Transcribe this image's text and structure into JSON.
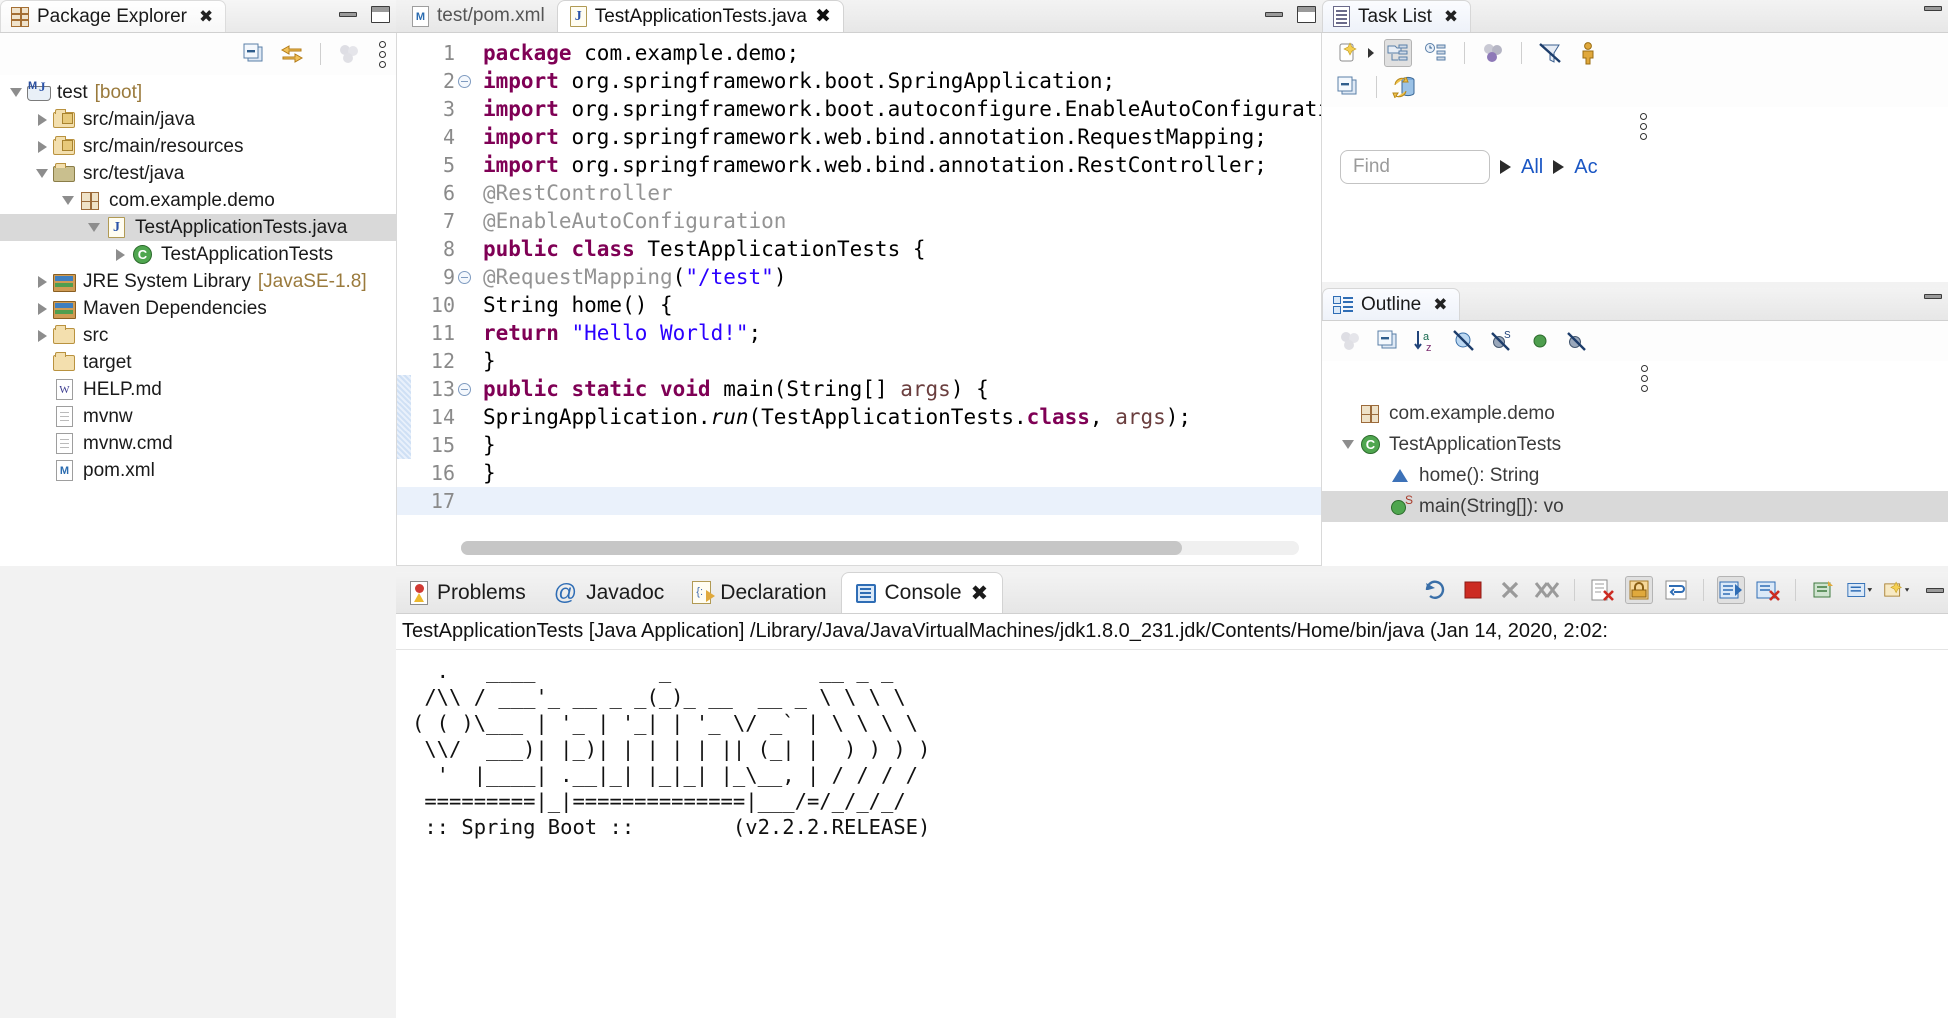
{
  "package_explorer": {
    "tab_label": "Package Explorer",
    "close_icon": "close-icon",
    "toolbar": [
      {
        "name": "collapse-all-icon",
        "label": "Collapse All"
      },
      {
        "name": "link-with-editor-icon",
        "label": "Link with Editor"
      },
      {
        "name": "view-menu-icon",
        "label": "View Menu"
      },
      {
        "name": "view-kebab-icon",
        "label": "View Menu"
      }
    ],
    "tree": [
      {
        "label": "test",
        "suffix": "[boot]",
        "icon": "maven-java-project-icon",
        "twisty": "down",
        "indent": 0,
        "selected": false
      },
      {
        "label": "src/main/java",
        "suffix": "",
        "icon": "source-folder-icon",
        "twisty": "right",
        "indent": 1,
        "selected": false
      },
      {
        "label": "src/main/resources",
        "suffix": "",
        "icon": "source-folder-icon",
        "twisty": "right",
        "indent": 1,
        "selected": false
      },
      {
        "label": "src/test/java",
        "suffix": "",
        "icon": "test-source-folder-icon",
        "twisty": "down",
        "indent": 1,
        "selected": false
      },
      {
        "label": "com.example.demo",
        "suffix": "",
        "icon": "package-icon",
        "twisty": "down",
        "indent": 2,
        "selected": false
      },
      {
        "label": "TestApplicationTests.java",
        "suffix": "",
        "icon": "java-file-icon",
        "twisty": "down",
        "indent": 3,
        "selected": true
      },
      {
        "label": "TestApplicationTests",
        "suffix": "",
        "icon": "java-class-icon",
        "twisty": "right",
        "indent": 4,
        "selected": false
      },
      {
        "label": "JRE System Library",
        "suffix": "[JavaSE-1.8]",
        "icon": "library-icon",
        "twisty": "right",
        "indent": 1,
        "selected": false
      },
      {
        "label": "Maven Dependencies",
        "suffix": "",
        "icon": "library-icon",
        "twisty": "right",
        "indent": 1,
        "selected": false
      },
      {
        "label": "src",
        "suffix": "",
        "icon": "folder-icon",
        "twisty": "right",
        "indent": 1,
        "selected": false
      },
      {
        "label": "target",
        "suffix": "",
        "icon": "folder-icon",
        "twisty": "none",
        "indent": 1,
        "selected": false
      },
      {
        "label": "HELP.md",
        "suffix": "",
        "icon": "markdown-file-icon",
        "twisty": "none",
        "indent": 1,
        "selected": false
      },
      {
        "label": "mvnw",
        "suffix": "",
        "icon": "file-icon",
        "twisty": "none",
        "indent": 1,
        "selected": false
      },
      {
        "label": "mvnw.cmd",
        "suffix": "",
        "icon": "file-icon",
        "twisty": "none",
        "indent": 1,
        "selected": false
      },
      {
        "label": "pom.xml",
        "suffix": "",
        "icon": "xml-file-icon",
        "twisty": "none",
        "indent": 1,
        "selected": false
      }
    ]
  },
  "editor": {
    "tabs": [
      {
        "label": "test/pom.xml",
        "icon": "maven-file-icon",
        "active": false,
        "closable": false
      },
      {
        "label": "TestApplicationTests.java",
        "icon": "java-file-icon",
        "active": true,
        "closable": true
      }
    ],
    "lines": [
      {
        "n": "1",
        "fold": false,
        "marker": false,
        "cursor": false,
        "html": "<span class='kw'>package</span> com.example.demo;"
      },
      {
        "n": "2",
        "fold": true,
        "marker": false,
        "cursor": false,
        "html": "<span class='kw'>import</span> org.springframework.boot.SpringApplication;"
      },
      {
        "n": "3",
        "fold": false,
        "marker": false,
        "cursor": false,
        "html": "<span class='kw'>import</span> org.springframework.boot.autoconfigure.EnableAutoConfiguration;"
      },
      {
        "n": "4",
        "fold": false,
        "marker": false,
        "cursor": false,
        "html": "<span class='kw'>import</span> org.springframework.web.bind.annotation.RequestMapping;"
      },
      {
        "n": "5",
        "fold": false,
        "marker": false,
        "cursor": false,
        "html": "<span class='kw'>import</span> org.springframework.web.bind.annotation.RestController;"
      },
      {
        "n": "6",
        "fold": false,
        "marker": false,
        "cursor": false,
        "html": "<span class='ann'>@RestController</span>"
      },
      {
        "n": "7",
        "fold": false,
        "marker": false,
        "cursor": false,
        "html": "<span class='ann'>@EnableAutoConfiguration</span>"
      },
      {
        "n": "8",
        "fold": false,
        "marker": false,
        "cursor": false,
        "html": "<span class='kw'>public class</span> TestApplicationTests {"
      },
      {
        "n": "9",
        "fold": true,
        "marker": false,
        "cursor": false,
        "html": "<span class='ann'>@RequestMapping</span>(<span class='str'>\"/test\"</span>)"
      },
      {
        "n": "10",
        "fold": false,
        "marker": false,
        "cursor": false,
        "html": "String home() {"
      },
      {
        "n": "11",
        "fold": false,
        "marker": false,
        "cursor": false,
        "html": "<span class='kw'>return</span> <span class='str'>\"Hello World!\"</span>;"
      },
      {
        "n": "12",
        "fold": false,
        "marker": false,
        "cursor": false,
        "html": "}"
      },
      {
        "n": "13",
        "fold": true,
        "marker": true,
        "cursor": false,
        "html": "<span class='kw'>public static void</span> main(String[] <span class='param'>args</span>) {"
      },
      {
        "n": "14",
        "fold": false,
        "marker": true,
        "cursor": false,
        "html": "SpringApplication.<span class='ital'>run</span>(TestApplicationTests.<span class='kw'>class</span>, <span class='param'>args</span>);"
      },
      {
        "n": "15",
        "fold": false,
        "marker": true,
        "cursor": false,
        "html": "}"
      },
      {
        "n": "16",
        "fold": false,
        "marker": false,
        "cursor": false,
        "html": "}"
      },
      {
        "n": "17",
        "fold": false,
        "marker": false,
        "cursor": true,
        "html": ""
      }
    ]
  },
  "task_list": {
    "tab_label": "Task List",
    "toolbar": [
      {
        "name": "new-task-icon"
      },
      {
        "name": "categorized-presentation-icon"
      },
      {
        "name": "scheduled-presentation-icon"
      },
      {
        "name": "focus-on-workweek-icon"
      },
      {
        "name": "filter-completed-icon"
      },
      {
        "name": "show-all-tasks-icon"
      },
      {
        "name": "collapse-all-icon"
      },
      {
        "name": "synchronize-changed-icon"
      }
    ],
    "find_placeholder": "Find",
    "scope_all": "All",
    "scope_activate": "Ac"
  },
  "outline": {
    "tab_label": "Outline",
    "toolbar": [
      {
        "name": "focus-on-active-task-icon"
      },
      {
        "name": "collapse-all-icon"
      },
      {
        "name": "sort-alphabetically-icon"
      },
      {
        "name": "hide-fields-icon"
      },
      {
        "name": "hide-static-members-icon"
      },
      {
        "name": "hide-non-public-members-icon"
      },
      {
        "name": "hide-local-types-icon"
      }
    ],
    "items": [
      {
        "label": "com.example.demo",
        "suffix": "",
        "icon": "package-icon",
        "twisty": "none",
        "indent": 0,
        "selected": false
      },
      {
        "label": "TestApplicationTests",
        "suffix": "",
        "icon": "java-class-icon",
        "twisty": "down",
        "indent": 0,
        "selected": false
      },
      {
        "label": "home()",
        "suffix": " : String",
        "icon": "default-method-icon",
        "twisty": "none",
        "indent": 1,
        "selected": false
      },
      {
        "label": "main(String[])",
        "suffix": " : vo",
        "icon": "public-static-method-icon",
        "twisty": "none",
        "indent": 1,
        "selected": true
      }
    ]
  },
  "console_view": {
    "tabs": [
      {
        "label": "Problems",
        "icon": "problems-icon",
        "active": false,
        "closable": false
      },
      {
        "label": "Javadoc",
        "icon": "javadoc-at-icon",
        "active": false,
        "closable": false
      },
      {
        "label": "Declaration",
        "icon": "declaration-icon",
        "active": false,
        "closable": false
      },
      {
        "label": "Console",
        "icon": "console-icon",
        "active": true,
        "closable": true
      }
    ],
    "toolbar": [
      {
        "name": "relaunch-icon"
      },
      {
        "name": "terminate-icon"
      },
      {
        "name": "remove-launch-icon"
      },
      {
        "name": "remove-all-terminated-icon"
      },
      {
        "name": "clear-console-icon"
      },
      {
        "name": "scroll-lock-icon"
      },
      {
        "name": "word-wrap-icon"
      },
      {
        "name": "show-console-on-output-icon"
      },
      {
        "name": "pin-console-icon"
      },
      {
        "name": "open-console-icon"
      },
      {
        "name": "display-selected-console-icon"
      },
      {
        "name": "new-console-view-icon"
      }
    ],
    "launch_title": "TestApplicationTests [Java Application] /Library/Java/JavaVirtualMachines/jdk1.8.0_231.jdk/Contents/Home/bin/java (Jan 14, 2020, 2:02:",
    "banner": "  .   ____          _            __ _ _\n /\\\\ / ___'_ __ _ _(_)_ __  __ _ \\ \\ \\ \\\n( ( )\\___ | '_ | '_| | '_ \\/ _` | \\ \\ \\ \\\n \\\\/  ___)| |_)| | | | | || (_| |  ) ) ) )\n  '  |____| .__|_| |_|_| |_\\__, | / / / /\n =========|_|==============|___/=/_/_/_/",
    "banner_version": " :: Spring Boot ::        (v2.2.2.RELEASE)"
  },
  "colors": {
    "keyword": "#7f0055",
    "string": "#2a00ff",
    "annotation": "#949494",
    "link": "#1a56c4",
    "selection": "#d9d9d9",
    "cursor_line": "#eaf1fb",
    "suffix": "#9a7a3c"
  }
}
